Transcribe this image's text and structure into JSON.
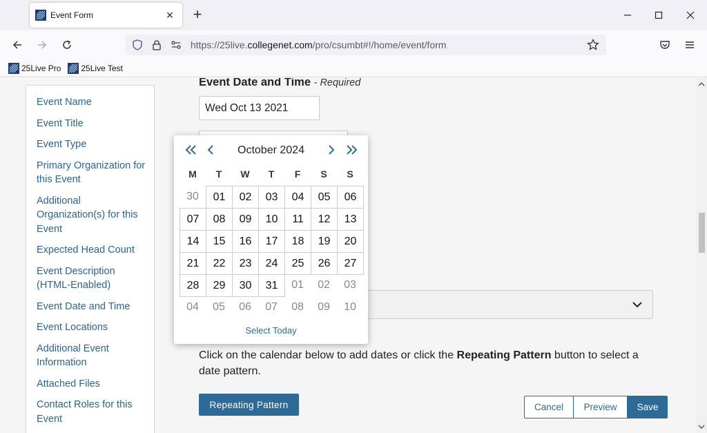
{
  "browser": {
    "tab_title": "Event Form",
    "url_prefix": "https://25live.",
    "url_domain": "collegenet.com",
    "url_path": "/pro/csumbt#!/home/event/form",
    "bookmarks": [
      "25Live Pro",
      "25Live Test"
    ]
  },
  "sidebar": {
    "items": [
      "Event Name",
      "Event Title",
      "Event Type",
      "Primary Organization for this Event",
      "Additional Organization(s) for this Event",
      "Expected Head Count",
      "Event Description (HTML-Enabled)",
      "Event Date and Time",
      "Event Locations",
      "Additional Event Information",
      "Attached Files",
      "Contact Roles for this Event"
    ]
  },
  "main": {
    "section_title": "Event Date and Time",
    "required_label": "- Required",
    "date_value": "Wed Oct 13 2021",
    "instructions_pre": "Click on the calendar below to add dates or click the ",
    "instructions_bold": "Repeating Pattern",
    "instructions_post": " button to select a date pattern.",
    "repeating_button": "Repeating Pattern",
    "cancel_button": "Cancel",
    "preview_button": "Preview",
    "save_button": "Save"
  },
  "datepicker": {
    "month_label": "October 2024",
    "weekdays": [
      "M",
      "T",
      "W",
      "T",
      "F",
      "S",
      "S"
    ],
    "weeks": [
      [
        {
          "d": "30",
          "o": true
        },
        {
          "d": "01"
        },
        {
          "d": "02"
        },
        {
          "d": "03"
        },
        {
          "d": "04"
        },
        {
          "d": "05"
        },
        {
          "d": "06"
        }
      ],
      [
        {
          "d": "07"
        },
        {
          "d": "08"
        },
        {
          "d": "09"
        },
        {
          "d": "10"
        },
        {
          "d": "11"
        },
        {
          "d": "12"
        },
        {
          "d": "13"
        }
      ],
      [
        {
          "d": "14"
        },
        {
          "d": "15"
        },
        {
          "d": "16"
        },
        {
          "d": "17"
        },
        {
          "d": "18"
        },
        {
          "d": "19"
        },
        {
          "d": "20"
        }
      ],
      [
        {
          "d": "21"
        },
        {
          "d": "22"
        },
        {
          "d": "23"
        },
        {
          "d": "24"
        },
        {
          "d": "25"
        },
        {
          "d": "26"
        },
        {
          "d": "27"
        }
      ],
      [
        {
          "d": "28"
        },
        {
          "d": "29"
        },
        {
          "d": "30"
        },
        {
          "d": "31"
        },
        {
          "d": "01",
          "o": true
        },
        {
          "d": "02",
          "o": true
        },
        {
          "d": "03",
          "o": true
        }
      ],
      [
        {
          "d": "04",
          "o": true
        },
        {
          "d": "05",
          "o": true
        },
        {
          "d": "06",
          "o": true
        },
        {
          "d": "07",
          "o": true
        },
        {
          "d": "08",
          "o": true
        },
        {
          "d": "09",
          "o": true
        },
        {
          "d": "10",
          "o": true
        }
      ]
    ],
    "select_today": "Select Today"
  },
  "colors": {
    "link": "#2a6496",
    "primary": "#2d6a96"
  }
}
